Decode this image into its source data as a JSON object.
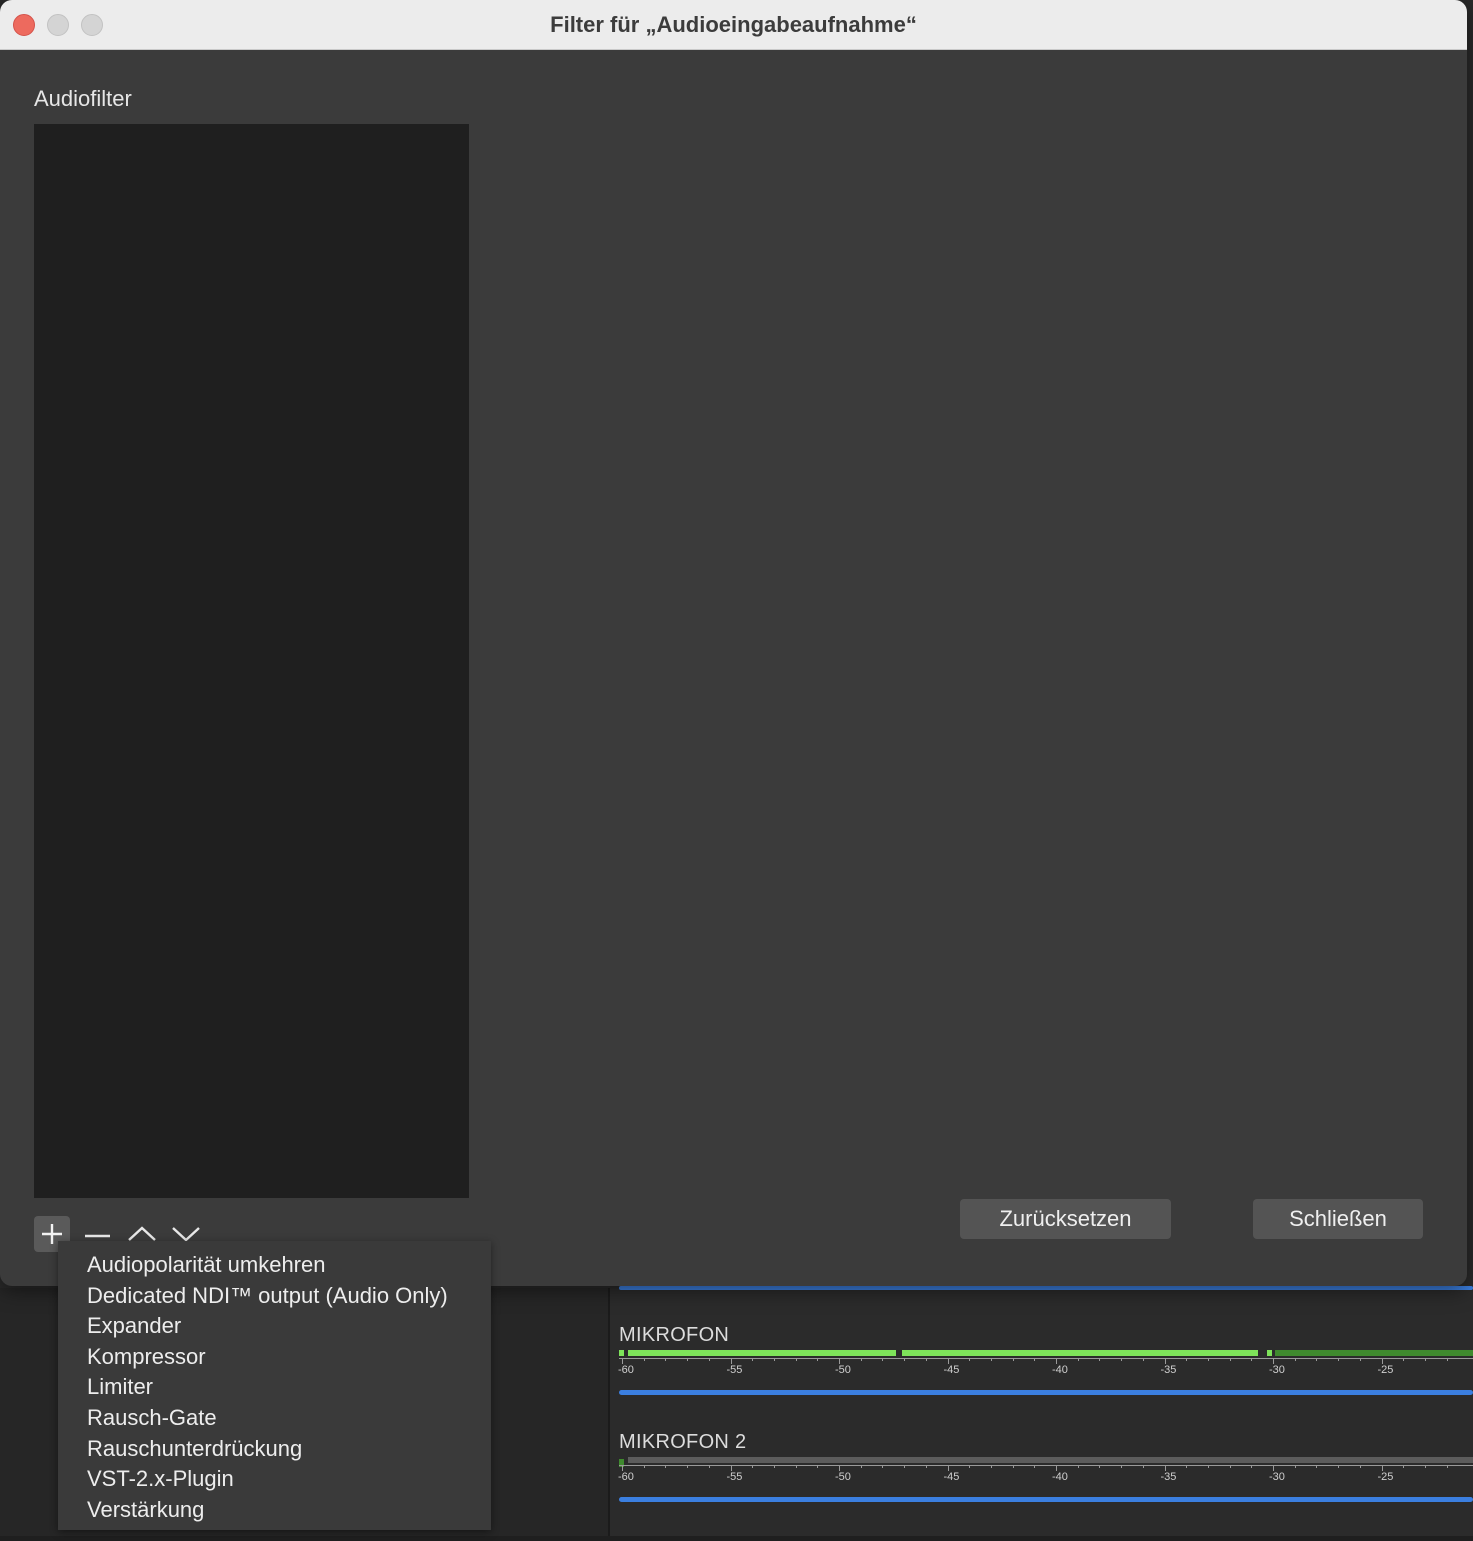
{
  "dialog": {
    "title": "Filter für „Audioeingabeaufnahme“",
    "section_label": "Audiofilter",
    "buttons": {
      "reset": "Zurücksetzen",
      "close": "Schließen"
    },
    "toolbar_icons": [
      "plus-icon",
      "minus-icon",
      "chevron-up-icon",
      "chevron-down-icon"
    ]
  },
  "add_filter_menu": {
    "items": [
      "Audiopolarität umkehren",
      "Dedicated NDI™ output (Audio Only)",
      "Expander",
      "Kompressor",
      "Limiter",
      "Rausch-Gate",
      "Rauschunterdrückung",
      "VST-2.x-Plugin",
      "Verstärkung"
    ]
  },
  "mixer": {
    "tracks": [
      {
        "name": "MIKROFON"
      },
      {
        "name": "MIKROFON 2"
      }
    ],
    "scale_labels": [
      "-60",
      "-55",
      "-50",
      "-45",
      "-40",
      "-35",
      "-30",
      "-25"
    ]
  },
  "colors": {
    "meter_green": "#7ee35a",
    "meter_dark_green": "#3f8a2e",
    "volume_blue": "#3b7fe0",
    "close_red": "#ed6a5e"
  }
}
